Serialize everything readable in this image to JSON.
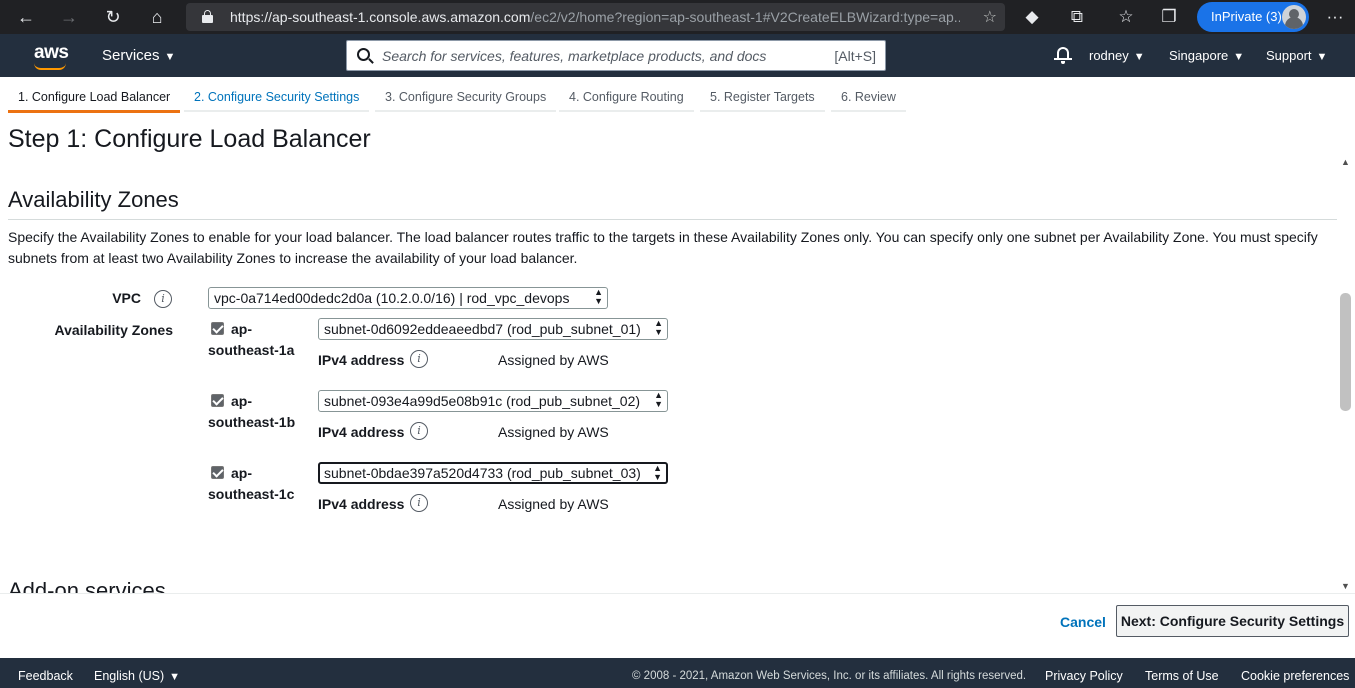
{
  "browser": {
    "url_main": "https://ap-southeast-1.console.aws.amazon.com",
    "url_rest": "/ec2/v2/home?region=ap-southeast-1#V2CreateELBWizard:type=ap...",
    "inprivate_label": "InPrivate (3)"
  },
  "header": {
    "logo": "aws",
    "services_label": "Services",
    "search_placeholder": "Search for services, features, marketplace products, and docs",
    "search_shortcut": "[Alt+S]",
    "user": "rodney",
    "region": "Singapore",
    "support": "Support"
  },
  "tabs": [
    {
      "label": "1. Configure Load Balancer"
    },
    {
      "label": "2. Configure Security Settings"
    },
    {
      "label": "3. Configure Security Groups"
    },
    {
      "label": "4. Configure Routing"
    },
    {
      "label": "5. Register Targets"
    },
    {
      "label": "6. Review"
    }
  ],
  "page_title": "Step 1: Configure Load Balancer",
  "section": {
    "title": "Availability Zones",
    "description": "Specify the Availability Zones to enable for your load balancer. The load balancer routes traffic to the targets in these Availability Zones only. You can specify only one subnet per Availability Zone. You must specify subnets from at least two Availability Zones to increase the availability of your load balancer.",
    "vpc_label": "VPC",
    "vpc_value": "vpc-0a714ed00dedc2d0a (10.2.0.0/16) | rod_vpc_devops",
    "az_label": "Availability Zones",
    "zones": [
      {
        "name_line1": "ap-",
        "name_line2": "southeast-1a",
        "subnet": "subnet-0d6092eddeaeedbd7 (rod_pub_subnet_01)",
        "ipv4_label": "IPv4 address",
        "ipv4_value": "Assigned by AWS",
        "checked": true
      },
      {
        "name_line1": "ap-",
        "name_line2": "southeast-1b",
        "subnet": "subnet-093e4a99d5e08b91c (rod_pub_subnet_02)",
        "ipv4_label": "IPv4 address",
        "ipv4_value": "Assigned by AWS",
        "checked": true
      },
      {
        "name_line1": "ap-",
        "name_line2": "southeast-1c",
        "subnet": "subnet-0bdae397a520d4733 (rod_pub_subnet_03)",
        "ipv4_label": "IPv4 address",
        "ipv4_value": "Assigned by AWS",
        "checked": true
      }
    ],
    "next_section_title": "Add-on services"
  },
  "actions": {
    "cancel": "Cancel",
    "next": "Next: Configure Security Settings"
  },
  "footer": {
    "feedback": "Feedback",
    "language": "English (US)",
    "copyright": "© 2008 - 2021, Amazon Web Services, Inc. or its affiliates. All rights reserved.",
    "privacy": "Privacy Policy",
    "terms": "Terms of Use",
    "cookies": "Cookie preferences"
  },
  "colors": {
    "accent": "#ec7211",
    "link": "#0073bb",
    "header_bg": "#232f3e"
  }
}
